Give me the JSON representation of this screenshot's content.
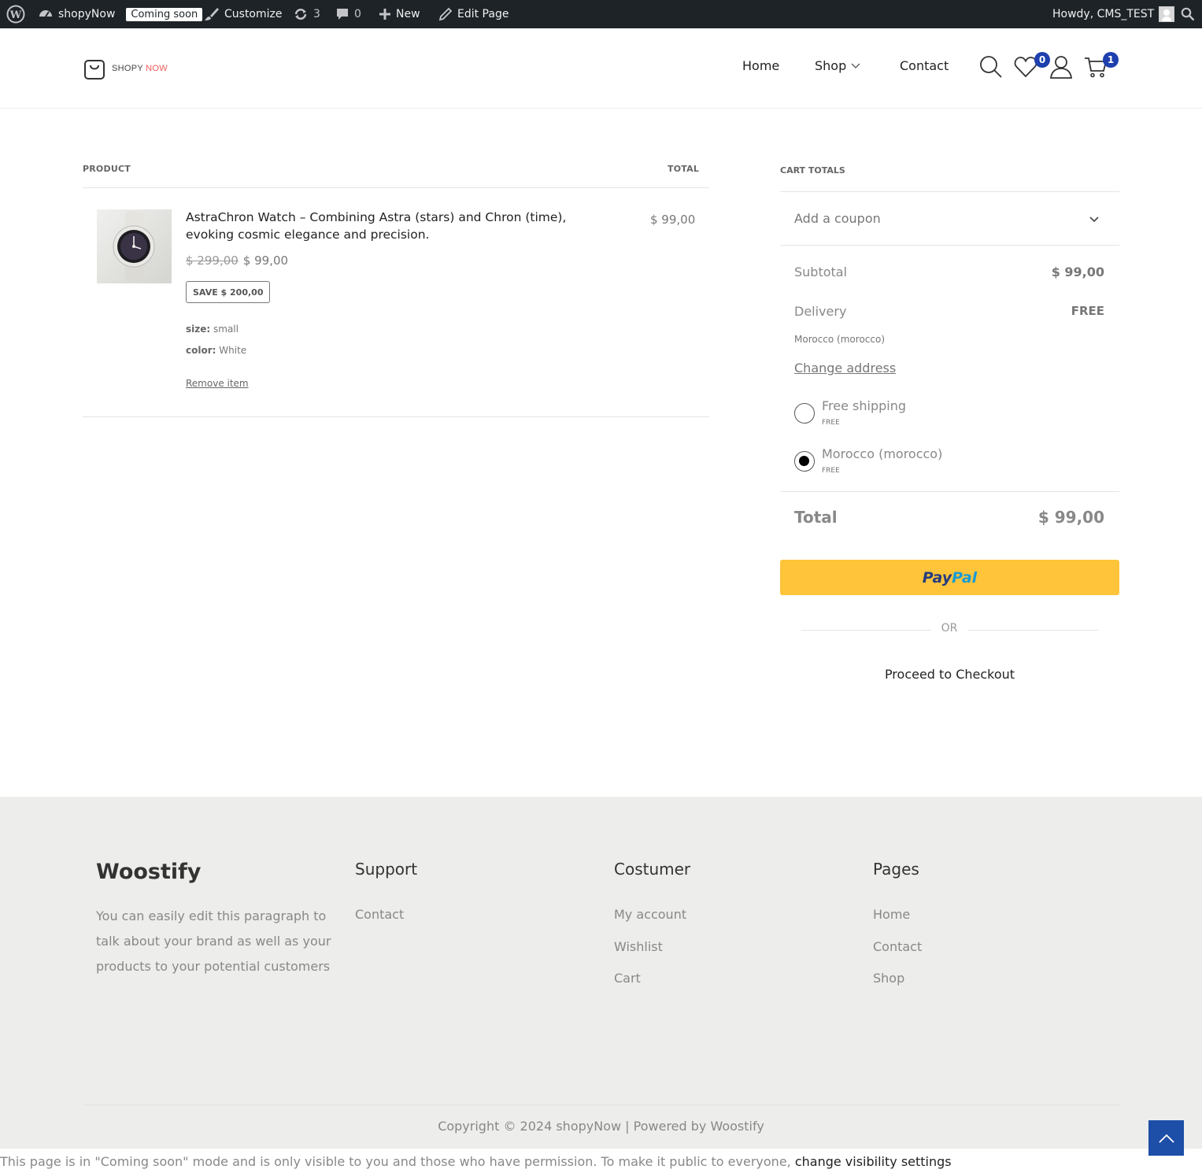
{
  "admin_bar": {
    "site_name": "shopyNow",
    "coming_soon": "Coming soon",
    "customize": "Customize",
    "updates_count": "3",
    "comments_count": "0",
    "new_label": "New",
    "edit_page": "Edit Page",
    "howdy": "Howdy, CMS_TEST"
  },
  "header": {
    "logo_left": "SHOPY ",
    "logo_right": "NOW",
    "nav": {
      "home": "Home",
      "shop": "Shop",
      "contact": "Contact"
    },
    "wishlist_count": "0",
    "cart_count": "1"
  },
  "cart": {
    "col_product": "PRODUCT",
    "col_total": "TOTAL",
    "item": {
      "title": "AstraChron Watch – Combining Astra (stars) and Chron (time), evoking cosmic elegance and precision.",
      "old_price": "$ 299,00",
      "price": "$ 99,00",
      "save": "SAVE $ 200,00",
      "size_label": "size:",
      "size_value": "small",
      "color_label": "color:",
      "color_value": "White",
      "remove": "Remove item",
      "line_total": "$ 99,00"
    }
  },
  "totals": {
    "title": "CART TOTALS",
    "coupon": "Add a coupon",
    "subtotal_label": "Subtotal",
    "subtotal_value": "$ 99,00",
    "delivery_label": "Delivery",
    "delivery_value": "FREE",
    "delivery_location": "Morocco (morocco)",
    "change_address": "Change address",
    "shipping_options": [
      {
        "label": "Free shipping",
        "price": "FREE",
        "selected": false
      },
      {
        "label": "Morocco (morocco)",
        "price": "FREE",
        "selected": true
      }
    ],
    "total_label": "Total",
    "total_value": "$ 99,00",
    "paypal_pay": "Pay",
    "paypal_pal": "Pal",
    "or": "OR",
    "checkout": "Proceed to Checkout"
  },
  "footer": {
    "brand": "Woostify",
    "paragraph": "You can easily edit this paragraph to talk about your brand as well as your products to your potential customers",
    "support": {
      "heading": "Support",
      "links": [
        "Contact"
      ]
    },
    "customer": {
      "heading": "Costumer",
      "links": [
        "My account",
        "Wishlist",
        "Cart"
      ]
    },
    "pages": {
      "heading": "Pages",
      "links": [
        "Home",
        "Contact",
        "Shop"
      ]
    },
    "copyright": "Copyright © 2024 shopyNow | Powered by Woostify"
  },
  "notice": {
    "text": "This page is in \"Coming soon\" mode and is only visible to you and those who have permission. To make it public to everyone, ",
    "link": "change visibility settings"
  },
  "colors": {
    "admin_bar": "#1d2327",
    "badge": "#1e3fae",
    "paypal": "#ffc439",
    "footer_bg": "#ededeb",
    "logo_accent": "#f05a5a"
  }
}
